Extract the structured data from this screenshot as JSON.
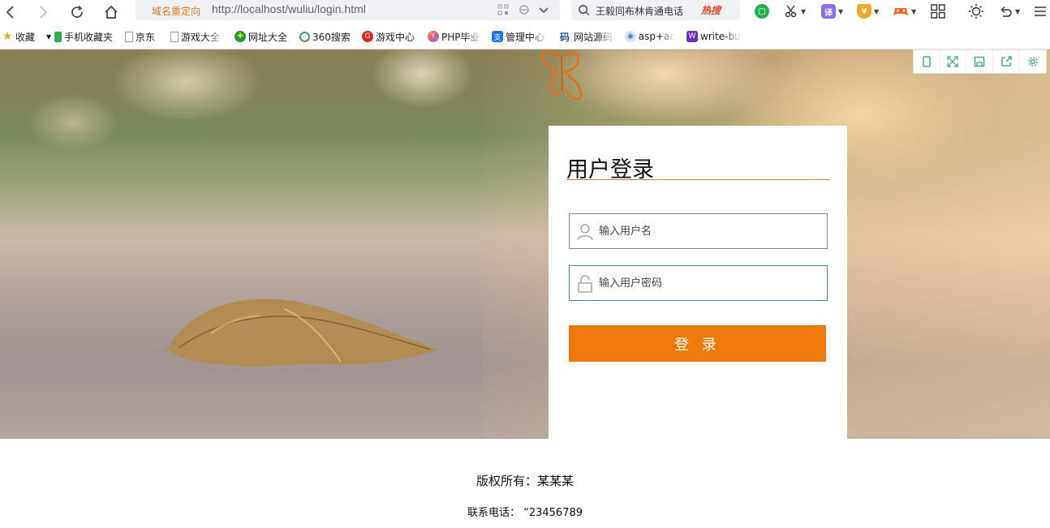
{
  "browser": {
    "address_label": "域名重定向",
    "url": "http://localhost/wuliu/login.html",
    "search_hint": "王毅同布林肯通电话",
    "search_hot": "热搜",
    "ext_translate": "译"
  },
  "bookmarks": [
    {
      "label": "收藏",
      "icon": "star-icon",
      "color": "#f4a72c"
    },
    {
      "label": "手机收藏夹",
      "icon": "phone-icon",
      "color": "#2eaa4f"
    },
    {
      "label": "京东",
      "icon": "page-icon",
      "color": "#999999"
    },
    {
      "label": "游戏大全",
      "icon": "page-icon",
      "color": "#999999"
    },
    {
      "label": "网址大全",
      "icon": "hao123-icon",
      "color": "#1d9a3c"
    },
    {
      "label": "360搜索",
      "icon": "so-icon",
      "color": "#2eaa4f"
    },
    {
      "label": "游戏中心",
      "icon": "game-center-icon",
      "color": "#d9281f"
    },
    {
      "label": "PHP毕业",
      "icon": "php-icon",
      "color": "#e44b8a"
    },
    {
      "label": "管理中心",
      "icon": "alipay-icon",
      "color": "#1a73e8"
    },
    {
      "label": "网站源码",
      "icon": "code-icon",
      "color": "#2a5ba8"
    },
    {
      "label": "asp+ac",
      "icon": "globe-icon",
      "color": "#3a7bd5"
    },
    {
      "label": "write-bu",
      "icon": "write-icon",
      "color": "#6b2fc4"
    }
  ],
  "login": {
    "title": "用户登录",
    "username_placeholder": "输入用户名",
    "password_placeholder": "输入用户密码",
    "submit_label": "登 录"
  },
  "footer": {
    "copyright": "版权所有：某某某",
    "phone": "联系电话：  “23456789"
  },
  "colors": {
    "accent": "#ee7a0b",
    "title_rule": "#e07a1f",
    "focus_border": "#3f8ea0"
  }
}
